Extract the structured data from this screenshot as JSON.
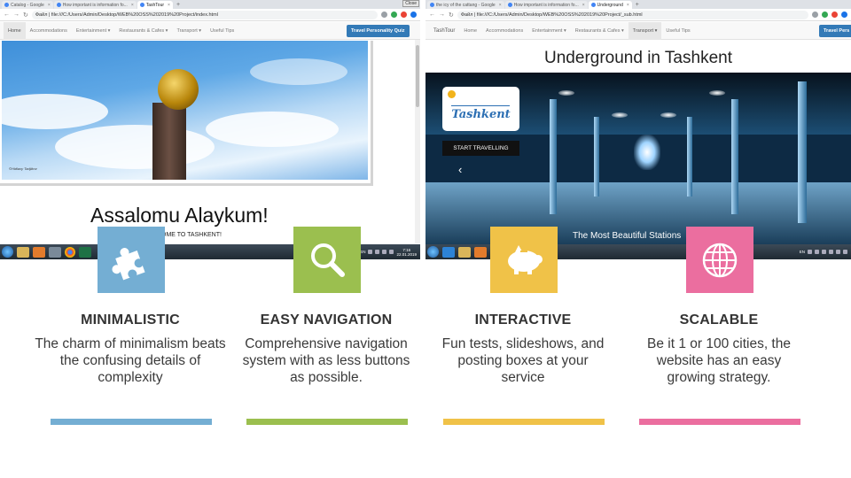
{
  "colors": {
    "blue": "#74aed3",
    "green": "#9bbf4f",
    "yellow": "#f0c248",
    "pink": "#eb6e9f",
    "nav_button": "#337ab7"
  },
  "left_browser": {
    "tabs": [
      "Catalog - Google",
      "How important is information fo...",
      "TashTour"
    ],
    "close_badge": "Close",
    "url": "Файл | file:///C:/Users/Admin/Desktop/WEB%20OSS%202019%20Project/index.html",
    "nav_items": [
      "Home",
      "Accommodations",
      "Entertainment ▾",
      "Restaurants & Cafes ▾",
      "Transport ▾",
      "Useful Tips"
    ],
    "quiz_button": "Travel Personality Quiz",
    "hero_watermark": "©Hidlaxy Tadjikov",
    "greeting": "Assalomu Alaykum!",
    "welcome": "OME TO TASHKENT!",
    "tray_lang": "EN",
    "clock_time": "7:16",
    "clock_date": "22.01.2019"
  },
  "right_browser": {
    "tabs": [
      "the icy of the cattang - Google",
      "How important is information fo...",
      "Underground"
    ],
    "url": "Файл | file:///C:/Users/Admin/Desktop/WEB%20OSS%202019%20Project/_sub.html",
    "nav_brand": "TashTour",
    "nav_items": [
      "Home",
      "Accommodations",
      "Entertainment ▾",
      "Restaurants & Cafes ▾",
      "Transport ▾",
      "Useful Tips"
    ],
    "quiz_button": "Travel Pers",
    "page_title": "Underground in Tashkent",
    "logo_text": "Tashkent",
    "start_button": "START TRAVELLING",
    "caption": "The Most Beautiful Stations",
    "tray_lang": "EN"
  },
  "features": [
    {
      "icon": "puzzle-icon",
      "title": "MINIMALISTIC",
      "desc": "The charm of minimalism beats the confusing details of complexity"
    },
    {
      "icon": "magnifier-icon",
      "title": "EASY NAVIGATION",
      "desc": "Comprehensive navigation system with as less buttons as possible."
    },
    {
      "icon": "piggy-bank-icon",
      "title": "INTERACTIVE",
      "desc": "Fun tests, slideshows, and posting boxes at your service"
    },
    {
      "icon": "globe-icon",
      "title": "SCALABLE",
      "desc": "Be it 1 or 100 cities, the website has an easy growing strategy."
    }
  ]
}
